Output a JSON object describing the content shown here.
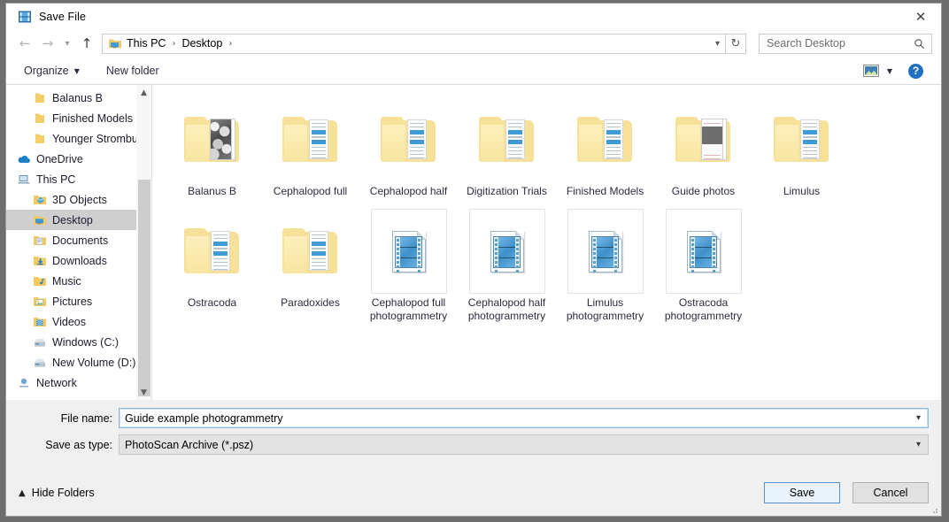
{
  "window": {
    "title": "Save File",
    "title_icon": "photoscan-film-icon",
    "close_icon": "close-icon"
  },
  "nav": {
    "back_icon": "arrow-left-icon",
    "forward_icon": "arrow-right-icon",
    "recent_icon": "chevron-down-icon",
    "up_icon": "arrow-up-icon",
    "folder_icon": "desktop-folder-icon",
    "breadcrumbs": [
      "This PC",
      "Desktop"
    ],
    "separator": "›",
    "address_caret_icon": "chevron-down-icon",
    "refresh_icon": "refresh-icon"
  },
  "search": {
    "placeholder": "Search Desktop",
    "value": "",
    "icon": "search-icon"
  },
  "command_bar": {
    "organize": "Organize",
    "organize_caret_icon": "caret-down-icon",
    "new_folder": "New folder",
    "view_icon": "view-mode-icon",
    "view_caret_icon": "caret-down-icon",
    "help_icon": "help-icon",
    "help_label": "?"
  },
  "sidebar": {
    "items": [
      {
        "label": "Balanus B",
        "icon": "folder-icon",
        "level": 2,
        "selected": false
      },
      {
        "label": "Finished Models",
        "icon": "folder-icon",
        "level": 2,
        "selected": false
      },
      {
        "label": "Younger Strombu",
        "icon": "folder-icon",
        "level": 2,
        "selected": false
      },
      {
        "label": "OneDrive",
        "icon": "onedrive-icon",
        "level": 1,
        "selected": false
      },
      {
        "label": "This PC",
        "icon": "this-pc-icon",
        "level": 1,
        "selected": false
      },
      {
        "label": "3D Objects",
        "icon": "3d-objects-icon",
        "level": 2,
        "selected": false
      },
      {
        "label": "Desktop",
        "icon": "desktop-icon",
        "level": 2,
        "selected": true
      },
      {
        "label": "Documents",
        "icon": "documents-icon",
        "level": 2,
        "selected": false
      },
      {
        "label": "Downloads",
        "icon": "downloads-icon",
        "level": 2,
        "selected": false
      },
      {
        "label": "Music",
        "icon": "music-icon",
        "level": 2,
        "selected": false
      },
      {
        "label": "Pictures",
        "icon": "pictures-icon",
        "level": 2,
        "selected": false
      },
      {
        "label": "Videos",
        "icon": "videos-icon",
        "level": 2,
        "selected": false
      },
      {
        "label": "Windows (C:)",
        "icon": "drive-icon",
        "level": 2,
        "selected": false
      },
      {
        "label": "New Volume (D:)",
        "icon": "drive-icon",
        "level": 2,
        "selected": false
      },
      {
        "label": "Network",
        "icon": "network-icon",
        "level": 1,
        "selected": false
      }
    ],
    "scroll_up_icon": "chevron-up-icon",
    "scroll_down_icon": "chevron-down-icon"
  },
  "files": [
    {
      "name": "Balanus B",
      "type": "folder",
      "thumb": "photo"
    },
    {
      "name": "Cephalopod full",
      "type": "folder",
      "thumb": "document"
    },
    {
      "name": "Cephalopod half",
      "type": "folder",
      "thumb": "document"
    },
    {
      "name": "Digitization Trials",
      "type": "folder",
      "thumb": "document"
    },
    {
      "name": "Finished Models",
      "type": "folder",
      "thumb": "document"
    },
    {
      "name": "Guide photos",
      "type": "folder",
      "thumb": "guide"
    },
    {
      "name": "Limulus",
      "type": "folder",
      "thumb": "document"
    },
    {
      "name": "Ostracoda",
      "type": "folder",
      "thumb": "document"
    },
    {
      "name": "Paradoxides",
      "type": "folder",
      "thumb": "document"
    },
    {
      "name": "Cephalopod full photogrammetry",
      "type": "file",
      "thumb": "psz"
    },
    {
      "name": "Cephalopod half photogrammetry",
      "type": "file",
      "thumb": "psz"
    },
    {
      "name": "Limulus photogrammetry",
      "type": "file",
      "thumb": "psz"
    },
    {
      "name": "Ostracoda photogrammetry",
      "type": "file",
      "thumb": "psz"
    }
  ],
  "form": {
    "file_name_label": "File name:",
    "file_name_value": "Guide example photogrammetry",
    "file_name_caret_icon": "chevron-down-icon",
    "save_as_type_label": "Save as type:",
    "save_as_type_value": "PhotoScan Archive (*.psz)",
    "save_as_type_caret_icon": "chevron-down-icon"
  },
  "footer": {
    "hide_folders_label": "Hide Folders",
    "hide_folders_caret_icon": "chevron-up-icon",
    "save_label": "Save",
    "cancel_label": "Cancel",
    "resize_grip_icon": "resize-grip-icon"
  },
  "colors": {
    "accent": "#1f6fc4",
    "folder": "#f7e198",
    "selection": "#cfcfcf",
    "default_button_border": "#4f93d4"
  }
}
